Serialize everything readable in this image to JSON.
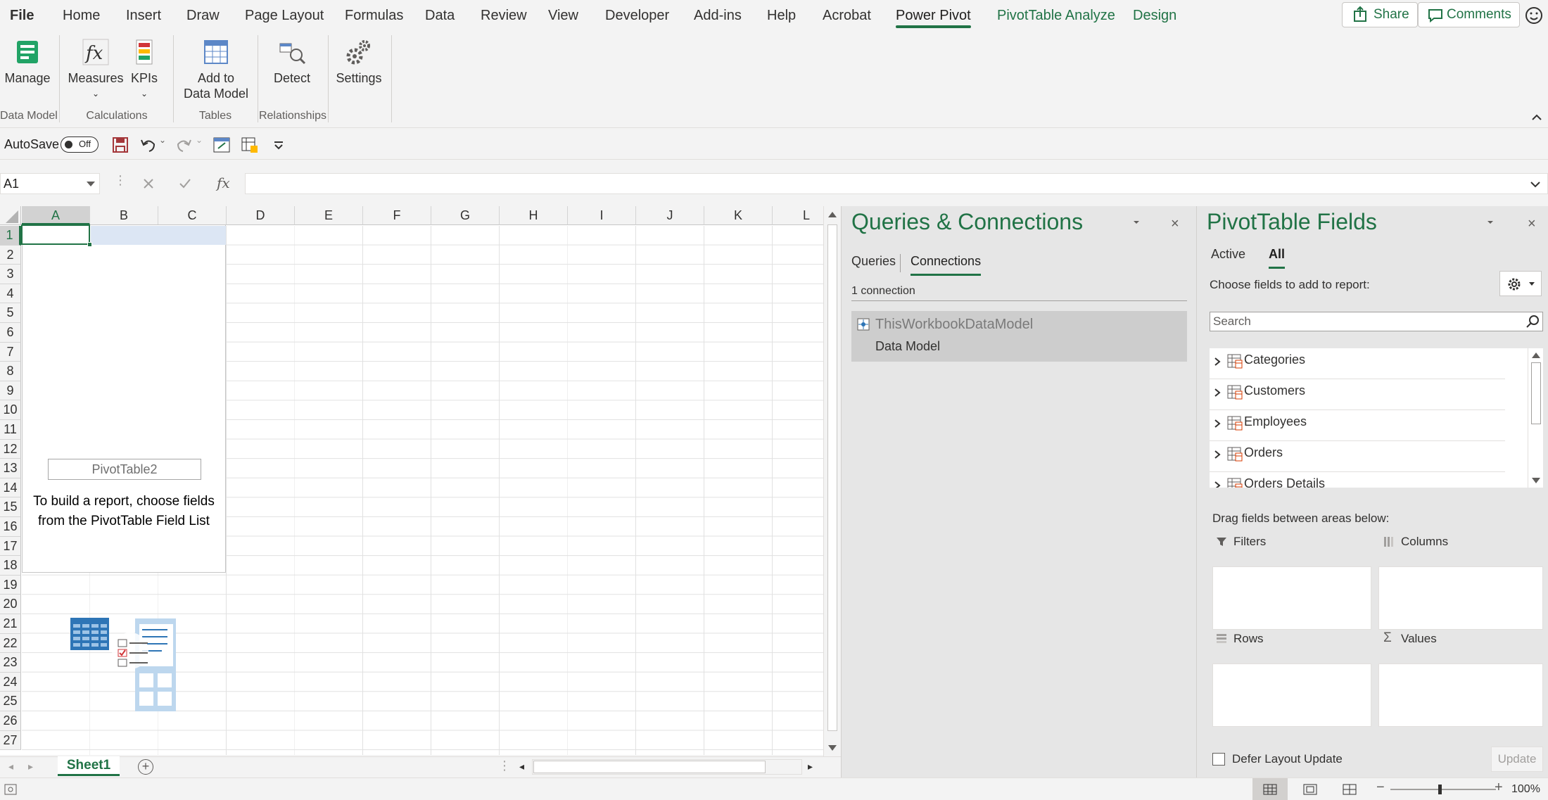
{
  "menu": {
    "tabs": [
      {
        "label": "File"
      },
      {
        "label": "Home"
      },
      {
        "label": "Insert"
      },
      {
        "label": "Draw"
      },
      {
        "label": "Page Layout"
      },
      {
        "label": "Formulas"
      },
      {
        "label": "Data"
      },
      {
        "label": "Review"
      },
      {
        "label": "View"
      },
      {
        "label": "Developer"
      },
      {
        "label": "Add-ins"
      },
      {
        "label": "Help"
      },
      {
        "label": "Acrobat"
      },
      {
        "label": "Power Pivot"
      },
      {
        "label": "PivotTable Analyze"
      },
      {
        "label": "Design"
      }
    ],
    "share_label": "Share",
    "comments_label": "Comments"
  },
  "ribbon": {
    "manage_label": "Manage",
    "measures_label": "Measures",
    "kpis_label": "KPIs",
    "add_to_data_model_line1": "Add to",
    "add_to_data_model_line2": "Data Model",
    "detect_label": "Detect",
    "settings_label": "Settings",
    "groups": {
      "data_model": "Data Model",
      "calculations": "Calculations",
      "tables": "Tables",
      "relationships": "Relationships"
    }
  },
  "qat": {
    "autosave_label": "AutoSave",
    "toggle_state": "Off"
  },
  "formula_bar": {
    "name_box": "A1",
    "fx_label": "fx"
  },
  "sheet": {
    "columns": [
      "A",
      "B",
      "C",
      "D",
      "E",
      "F",
      "G",
      "H",
      "I",
      "J",
      "K",
      "L"
    ],
    "rows": [
      "1",
      "2",
      "3",
      "4",
      "5",
      "6",
      "7",
      "8",
      "9",
      "10",
      "11",
      "12",
      "13",
      "14",
      "15",
      "16",
      "17",
      "18",
      "19",
      "20",
      "21",
      "22",
      "23",
      "24",
      "25",
      "26",
      "27"
    ],
    "pivot_name": "PivotTable2",
    "pivot_msg_line1": "To build a report, choose fields",
    "pivot_msg_line2": "from the PivotTable Field List",
    "tab_label": "Sheet1",
    "add_sheet_label": "+"
  },
  "status": {
    "zoom": "100%"
  },
  "queries_pane": {
    "title": "Queries & Connections",
    "tab_queries": "Queries",
    "tab_connections": "Connections",
    "count": "1 connection",
    "item_name": "ThisWorkbookDataModel",
    "item_sub": "Data Model"
  },
  "fields_pane": {
    "title": "PivotTable Fields",
    "tab_active": "Active",
    "tab_all": "All",
    "choose_label": "Choose fields to add to report:",
    "search_placeholder": "Search",
    "tables": [
      "Categories",
      "Customers",
      "Employees",
      "Orders",
      "Orders Details"
    ],
    "drag_label": "Drag fields between areas below:",
    "filters_label": "Filters",
    "columns_label": "Columns",
    "rows_label": "Rows",
    "values_label": "Values",
    "defer_label": "Defer Layout Update",
    "update_label": "Update"
  },
  "colors": {
    "accent": "#217346",
    "pane_bg": "#e6e6e6"
  }
}
